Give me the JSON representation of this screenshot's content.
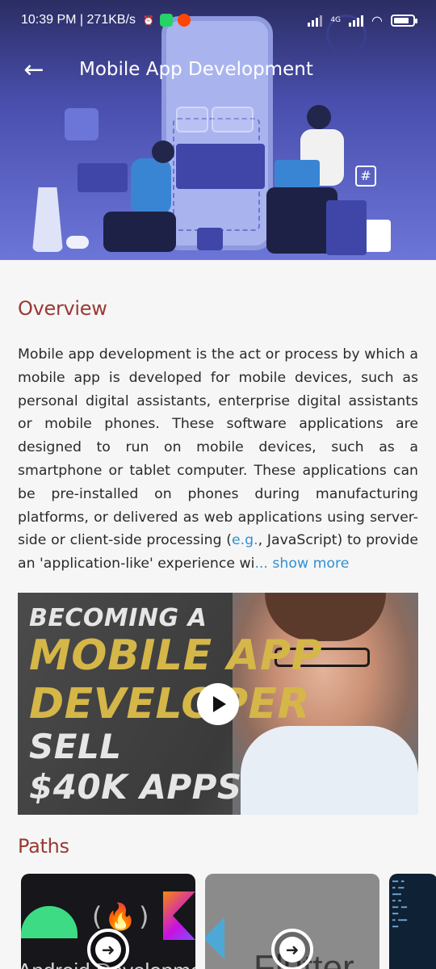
{
  "status_bar": {
    "time": "10:39 PM",
    "speed": "271KB/s",
    "network": "4G"
  },
  "header": {
    "title": "Mobile App Development",
    "back_icon": "arrow-left-icon"
  },
  "overview": {
    "title": "Overview",
    "text_before_link": "Mobile app development is the act or process by which a mobile app is developed for mobile devices, such as personal digital assistants, enterprise digital assistants or mobile phones. These software applications are designed to run on mobile devices, such as a smartphone or tablet computer. These applications can be pre-installed on phones during manufacturing platforms, or delivered as web applications using server-side or client-side processing (",
    "link_text": "e.g.",
    "text_after_link": ", JavaScript) to provide an 'application-like' experience wi",
    "show_more": "... show more"
  },
  "video": {
    "line1": "BECOMING A",
    "line2": "MOBILE APP",
    "line3": "DEVELOPER",
    "line4": "SELL",
    "line5": "$40K APPS"
  },
  "paths": {
    "title": "Paths",
    "cards": [
      {
        "label": "Android Development"
      },
      {
        "label": "Flutter"
      }
    ]
  },
  "colors": {
    "accent_title": "#993a34",
    "link": "#2f8fd4",
    "hero": "#4a4fae"
  }
}
